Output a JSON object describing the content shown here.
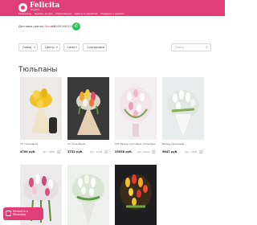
{
  "header": {
    "brand": "Felicita",
    "brand_sub": "flowers",
    "nav": [
      "Тюльпаны",
      "Букеты из роз",
      "Композиции",
      "Цветы в коробках",
      "Подарки к цветам"
    ]
  },
  "subbar": {
    "delivery_label": "Доставка цветов",
    "delivery_city": "Москва",
    "phone": "+7(909)949103"
  },
  "filters": {
    "items": [
      {
        "label": "Повод"
      },
      {
        "label": "Цветы"
      },
      {
        "label": "Цена"
      },
      {
        "label": "Сортировка"
      }
    ],
    "search_placeholder": "Поиск"
  },
  "page_title": "Тюльпаны",
  "products": [
    {
      "name": "15 тюльпанов",
      "price": "4700 руб.",
      "sku": "Арт. 3384"
    },
    {
      "name": "15 тюльпанов",
      "price": "3752 руб.",
      "sku": "Арт. 1118"
    },
    {
      "name": "101 белые и розовые тюльпаны",
      "price": "25058 руб.",
      "sku": "Арт. 2224"
    },
    {
      "name": "Белые тюльпаны",
      "price": "9847 руб.",
      "sku": "Арт. 1208"
    },
    {
      "name": "",
      "price": "",
      "sku": ""
    },
    {
      "name": "",
      "price": "",
      "sku": ""
    },
    {
      "name": "",
      "price": "",
      "sku": ""
    }
  ],
  "chat": {
    "label": "Написать в WhatsApp"
  },
  "colors": {
    "brand": "#df3f76",
    "whatsapp": "#27c35a"
  }
}
